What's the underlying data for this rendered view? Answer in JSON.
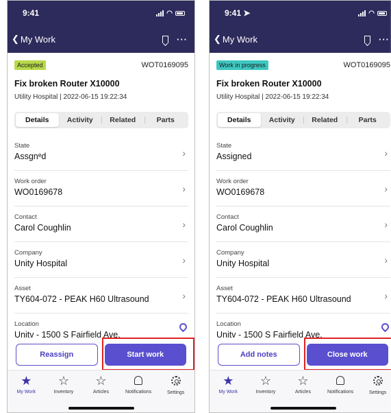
{
  "screens": [
    {
      "time": "9:41",
      "back_label": "My Work",
      "badge": "Accepted",
      "badge_color": "#b7d84b",
      "work_order_id": "WOT0169095",
      "title": "Fix broken Router X10000",
      "subtitle": "Utility Hospital | 2022-06-15  19:22:34",
      "tabs": [
        "Details",
        "Activity",
        "Related",
        "Parts"
      ],
      "fields": [
        {
          "label": "State",
          "value": "Assgnᵉd"
        },
        {
          "label": "Work order",
          "value": "WO0169678"
        },
        {
          "label": "Contact",
          "value": "Carol Coughlin"
        },
        {
          "label": "Company",
          "value": "Unity Hospital"
        },
        {
          "label": "Asset",
          "value": "TY604-072 - PEAK H60 Ultrasound"
        },
        {
          "label": "Location",
          "value": "Unitv - 1500 S Fairfield Ave."
        }
      ],
      "secondary_button": "Reassign",
      "primary_button": "Start work"
    },
    {
      "time": "9:41",
      "back_label": "My Work",
      "badge": "Work in progress",
      "badge_color": "#3ec7c0",
      "work_order_id": "WOT0169095",
      "title": "Fix broken Router X10000",
      "subtitle": "Utility Hospital | 2022-06-15  19:22:34",
      "tabs": [
        "Details",
        "Activity",
        "Related",
        "Parts"
      ],
      "fields": [
        {
          "label": "State",
          "value": "Assigned"
        },
        {
          "label": "Work order",
          "value": "WO0169678"
        },
        {
          "label": "Contact",
          "value": "Carol Coughlin"
        },
        {
          "label": "Company",
          "value": "Unity Hospital"
        },
        {
          "label": "Asset",
          "value": "TY604-072 - PEAK H60 Ultrasound"
        },
        {
          "label": "Location",
          "value": "Unitv - 1500 S Fairfield Ave."
        }
      ],
      "secondary_button": "Add notes",
      "primary_button": "Close work"
    }
  ],
  "tabbar": [
    {
      "label": "My Work",
      "icon": "star-filled-icon"
    },
    {
      "label": "Inventory",
      "icon": "star-outline-icon"
    },
    {
      "label": "Articles",
      "icon": "star-outline-icon"
    },
    {
      "label": "Notifications",
      "icon": "bell-icon"
    },
    {
      "label": "Settings",
      "icon": "gear-icon"
    }
  ],
  "colors": {
    "header_bg": "#2d2a5c",
    "accent": "#5a4fcf",
    "highlight": "#e02020"
  }
}
